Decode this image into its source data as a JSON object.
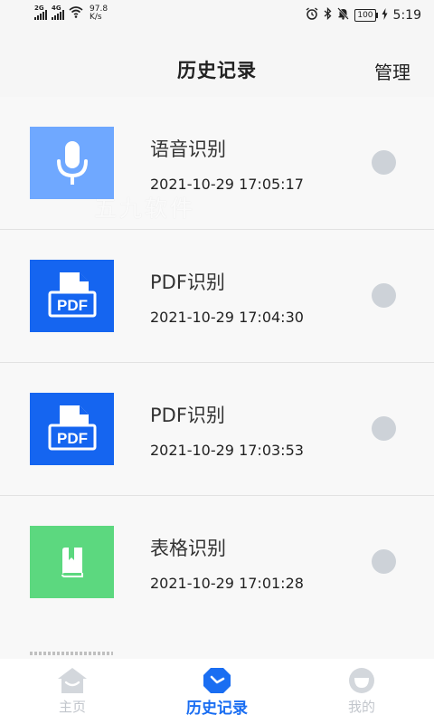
{
  "status_bar": {
    "signal_1_label": "2G",
    "signal_2_label": "4G",
    "net_speed_value": "97.8",
    "net_speed_unit": "K/s",
    "battery": "100",
    "time": "5:19"
  },
  "header": {
    "title": "历史记录",
    "manage_label": "管理"
  },
  "watermark": "五九软件",
  "history": [
    {
      "name": "语音识别",
      "time": "2021-10-29 17:05:17",
      "icon": "microphone-icon",
      "color": "#6fa8ff"
    },
    {
      "name": "PDF识别",
      "time": "2021-10-29 17:04:30",
      "icon": "pdf-file-icon",
      "color": "#1565f0"
    },
    {
      "name": "PDF识别",
      "time": "2021-10-29 17:03:53",
      "icon": "pdf-file-icon",
      "color": "#1565f0"
    },
    {
      "name": "表格识别",
      "time": "2021-10-29 17:01:28",
      "icon": "book-icon",
      "color": "#5cd87f"
    }
  ],
  "pdf_badge_text": "PDF",
  "tabs": [
    {
      "label": "主页",
      "icon": "home-icon",
      "active": false
    },
    {
      "label": "历史记录",
      "icon": "history-icon",
      "active": true
    },
    {
      "label": "我的",
      "icon": "profile-icon",
      "active": false
    }
  ],
  "colors": {
    "accent": "#1a6ef2",
    "inactive_tab": "#c2c6cc",
    "radio": "#cdd2d8"
  }
}
